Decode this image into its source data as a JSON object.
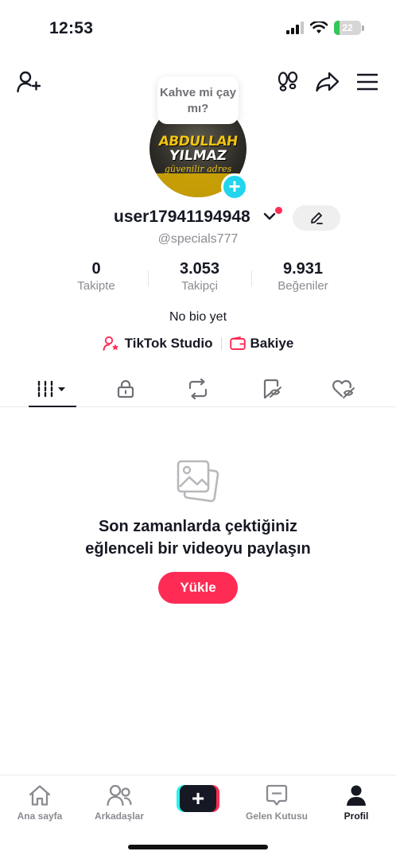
{
  "status_bar": {
    "time": "12:53",
    "battery": "22",
    "battery_level": 0.22
  },
  "profile": {
    "bubble_text": "Kahve mi çay mı?",
    "avatar_logo": {
      "line1": "ABDULLAH",
      "line2": "YILMAZ",
      "line3": "güvenilir adres"
    },
    "username": "user17941194948",
    "handle": "@specials777",
    "bio": "No bio yet"
  },
  "stats": [
    {
      "value": "0",
      "label": "Takipte"
    },
    {
      "value": "3.053",
      "label": "Takipçi"
    },
    {
      "value": "9.931",
      "label": "Beğeniler"
    }
  ],
  "links": {
    "studio": "TikTok Studio",
    "balance": "Bakiye"
  },
  "tabs": [
    "videos-tab",
    "private-tab",
    "reposts-tab",
    "saved-tab",
    "liked-tab"
  ],
  "empty_state": {
    "title": "Son zamanlarda çektiğiniz eğlenceli bir videoyu paylaşın",
    "button": "Yükle"
  },
  "bottom_nav": {
    "home": "Ana sayfa",
    "friends": "Arkadaşlar",
    "create": "+",
    "inbox": "Gelen Kutusu",
    "profile": "Profil"
  },
  "colors": {
    "accent": "#fe2c55",
    "cyan": "#25f4ee",
    "text": "#161823",
    "muted": "#8a8b91"
  }
}
